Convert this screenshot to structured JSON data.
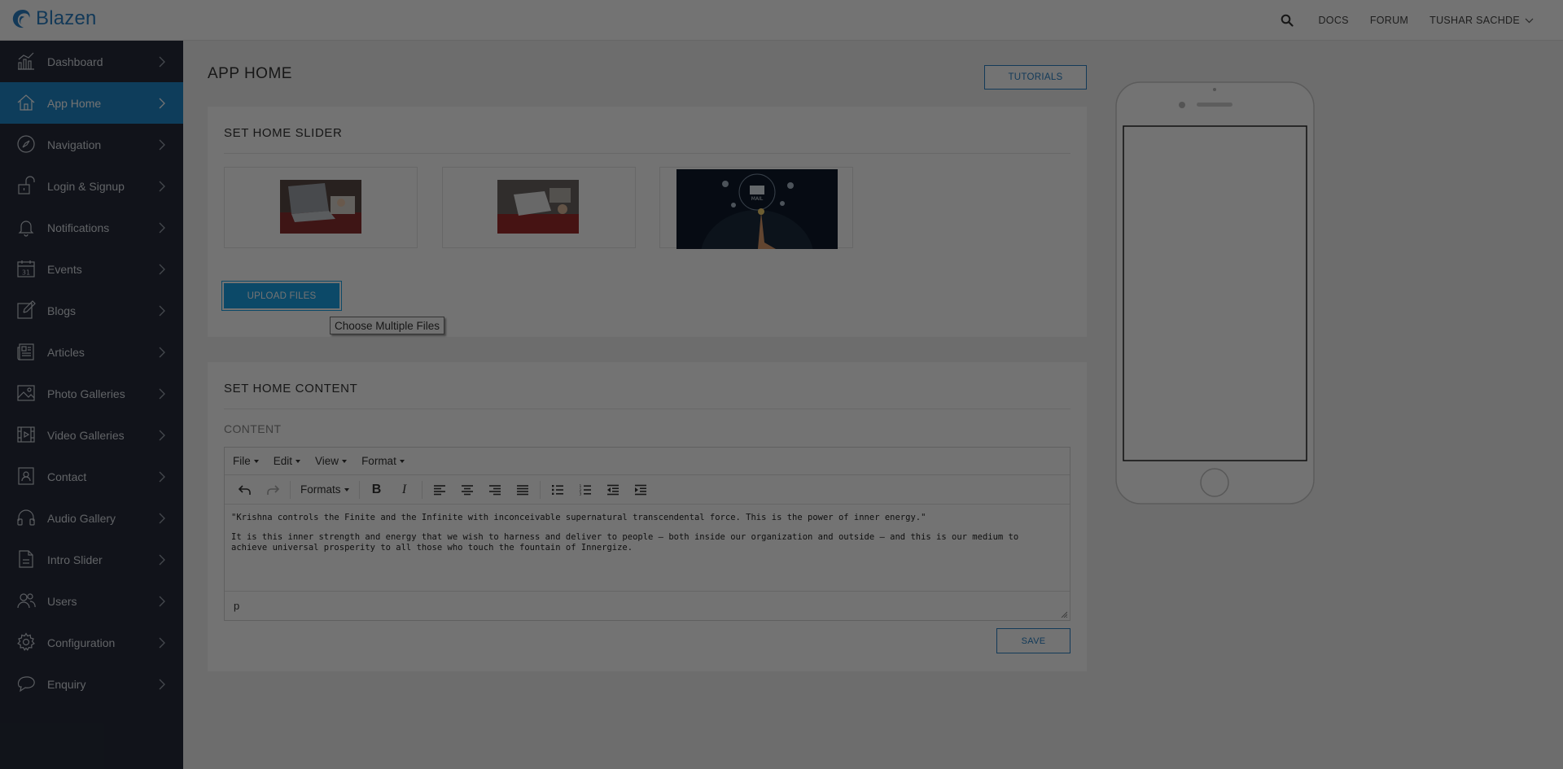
{
  "app": {
    "name": "Blazen"
  },
  "topbar": {
    "links": [
      "DOCS",
      "FORUM"
    ],
    "user": "TUSHAR SACHDE"
  },
  "sidebar": {
    "items": [
      {
        "label": "Dashboard",
        "icon": "chart-icon"
      },
      {
        "label": "App Home",
        "icon": "home-icon",
        "active": true
      },
      {
        "label": "Navigation",
        "icon": "compass-icon"
      },
      {
        "label": "Login & Signup",
        "icon": "lock-icon"
      },
      {
        "label": "Notifications",
        "icon": "bell-icon"
      },
      {
        "label": "Events",
        "icon": "calendar-icon"
      },
      {
        "label": "Blogs",
        "icon": "edit-icon"
      },
      {
        "label": "Articles",
        "icon": "newspaper-icon"
      },
      {
        "label": "Photo Galleries",
        "icon": "image-icon"
      },
      {
        "label": "Video Galleries",
        "icon": "film-icon"
      },
      {
        "label": "Contact",
        "icon": "contact-icon"
      },
      {
        "label": "Audio Gallery",
        "icon": "headphones-icon"
      },
      {
        "label": "Intro Slider",
        "icon": "document-icon"
      },
      {
        "label": "Users",
        "icon": "users-icon"
      },
      {
        "label": "Configuration",
        "icon": "gear-icon"
      },
      {
        "label": "Enquiry",
        "icon": "chat-icon"
      }
    ],
    "calendar_day": "31"
  },
  "page": {
    "title": "APP HOME",
    "tutorials_label": "TUTORIALS"
  },
  "slider": {
    "title": "SET HOME SLIDER",
    "upload_label": "UPLOAD FILES",
    "tooltip": "Choose Multiple Files",
    "mail_text": "MAIL"
  },
  "content": {
    "title": "SET HOME CONTENT",
    "label": "CONTENT",
    "menus": [
      "File",
      "Edit",
      "View",
      "Format"
    ],
    "formats_label": "Formats",
    "bold_label": "B",
    "italic_label": "I",
    "paragraphs": [
      " \"Krishna controls the Finite and the Infinite with inconceivable supernatural transcendental force. This is the power of inner energy.\"",
      "It is this inner strength and energy that we wish to harness and deliver to people – both inside our organization and outside – and this is our medium to achieve universal prosperity to all those who touch the fountain of Innergize."
    ],
    "status_path": "p",
    "save_label": "SAVE"
  },
  "colors": {
    "accent": "#2187c9",
    "sidebar_bg": "#262c3a",
    "upload_button": "#1ba2e6"
  }
}
